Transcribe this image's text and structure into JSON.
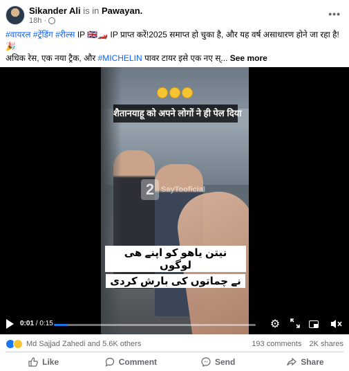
{
  "post": {
    "author": "Sikander Ali",
    "is_in": " is in ",
    "place": "Pawayan.",
    "time": "18h",
    "visibility_icon": "globe-icon",
    "more_icon": "more-horizontal-icon"
  },
  "caption": {
    "line1_tags": "#वायरल #ट्रेंडिंग #रील्स",
    "line1_rest": " IP 🇬🇧🏎️ IP प्राप्त करें!2025 समाप्त हो चुका है, और यह वर्ष असाधारण होने जा रहा है!",
    "line2": "🎉",
    "line3_start": "अधिक रेस, एक नया ट्रैक, और ",
    "line3_tag": "#MICHELIN",
    "line3_rest": " पावर टायर इसे एक नए स्...",
    "see_more": " See more"
  },
  "video": {
    "emojis": "😂😂😂",
    "hindi_banner": "शैतानयाहू को अपने लोगों ने ही पेल दिया",
    "watermark_logo": "2",
    "watermark": "SayTooficial",
    "urdu_line1": "نیتن یاھو کو اپنے ھی لوگوں",
    "urdu_line2": "نے چماتوں کی بارش کردی",
    "current_time": "0:01",
    "total_time": " / 0:15",
    "progress": 0.067
  },
  "controls": {
    "play_icon": "play-icon",
    "settings_icon": "gear-icon",
    "expand_icon": "expand-icon",
    "pip_icon": "picture-in-picture-icon",
    "volume_icon": "volume-muted-icon"
  },
  "stats": {
    "reactors": "Md Sajjad Zahedi and 5.6K others",
    "comments": "193 comments",
    "shares": "2K shares"
  },
  "actions": {
    "like": "Like",
    "comment": "Comment",
    "send": "Send",
    "share": "Share"
  },
  "colors": {
    "accent": "#0866ff",
    "progress": "#1b74e4",
    "muted_text": "#65676b"
  }
}
